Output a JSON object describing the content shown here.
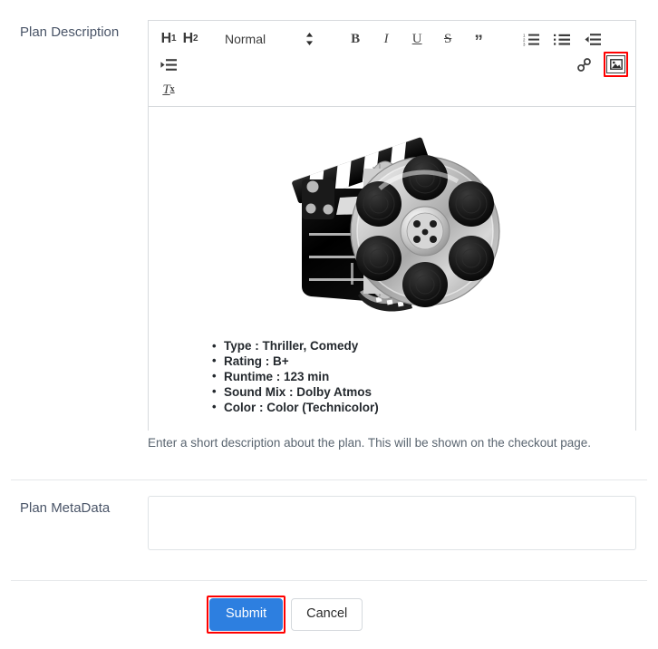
{
  "form": {
    "description_label": "Plan Description",
    "metadata_label": "Plan MetaData",
    "help_text": "Enter a short description about the plan. This will be shown on the checkout page.",
    "metadata_value": "",
    "metadata_placeholder": ""
  },
  "editor": {
    "toolbar": {
      "h1": "H1",
      "h1_text": "H",
      "h1_sub": "1",
      "h2_text": "H",
      "h2_sub": "2",
      "format_selected": "Normal",
      "format_arrows": "▴▾",
      "bold": "B",
      "italic": "I",
      "underline": "U",
      "strike": "S",
      "blockquote": "”",
      "clear_text": "T",
      "clear_sub": "x",
      "icons": {
        "ordered_list": "ordered-list-icon",
        "bullet_list": "bullet-list-icon",
        "outdent": "outdent-icon",
        "indent": "indent-icon",
        "link": "link-icon",
        "image": "image-icon"
      },
      "active_button": "image-icon"
    },
    "content": {
      "image_alt": "movie-clapperboard-film-reel",
      "bullets": [
        "Type : Thriller, Comedy",
        "Rating : B+",
        "Runtime : 123 min",
        "Sound Mix : Dolby Atmos",
        "Color : Color (Technicolor)"
      ]
    }
  },
  "footer": {
    "submit_label": "Submit",
    "cancel_label": "Cancel",
    "highlighted_button": "submit"
  },
  "colors": {
    "accent": "#2d7fe0",
    "highlight": "#ff0000",
    "label": "#4a5568",
    "border": "#d7dadd",
    "help_text": "#5a6570"
  }
}
